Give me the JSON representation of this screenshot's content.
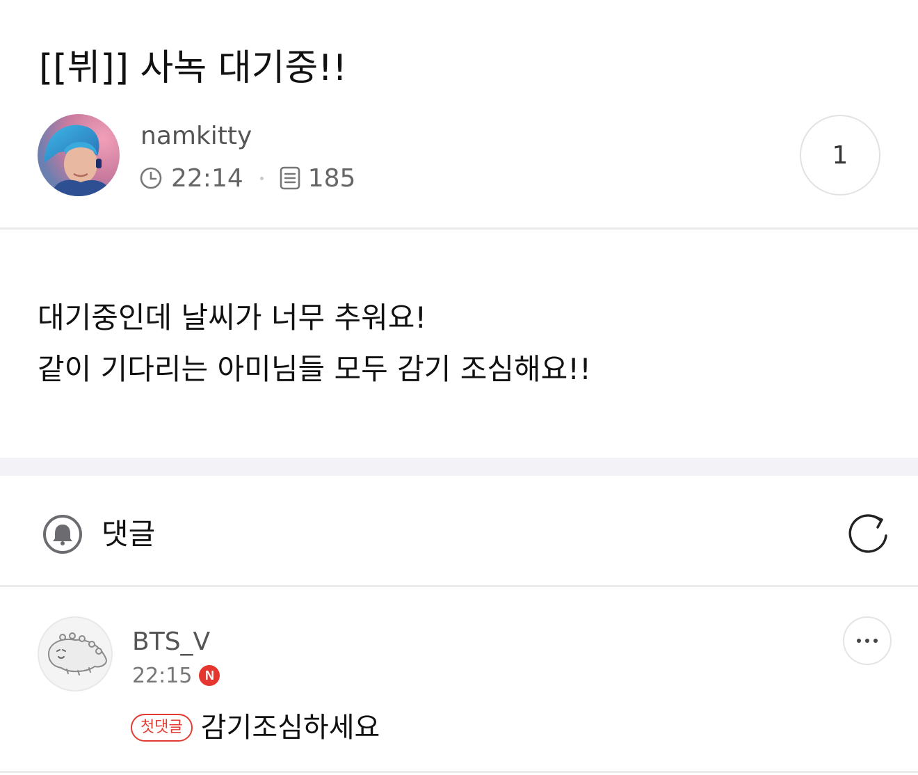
{
  "post": {
    "title": "[[뷔]] 사녹 대기중!!",
    "author": "namkitty",
    "time": "22:14",
    "views": "185",
    "comment_count": "1",
    "body_lines": [
      "대기중인데 날씨가 너무 추워요!",
      "같이 기다리는 아미님들 모두 감기 조심해요!!"
    ]
  },
  "comments_section": {
    "title": "댓글"
  },
  "comments": [
    {
      "author": "BTS_V",
      "time": "22:15",
      "new_badge": "N",
      "tag": "첫댓글",
      "text": "감기조심하세요"
    }
  ],
  "colors": {
    "accent_red": "#e5352f",
    "divider": "#e9e9ec",
    "section_gap": "#f3f3f7"
  },
  "icons": {
    "time": "clock-icon",
    "views": "document-icon",
    "comments_header": "bell-icon",
    "refresh": "refresh-icon",
    "more": "more-dots-icon"
  }
}
